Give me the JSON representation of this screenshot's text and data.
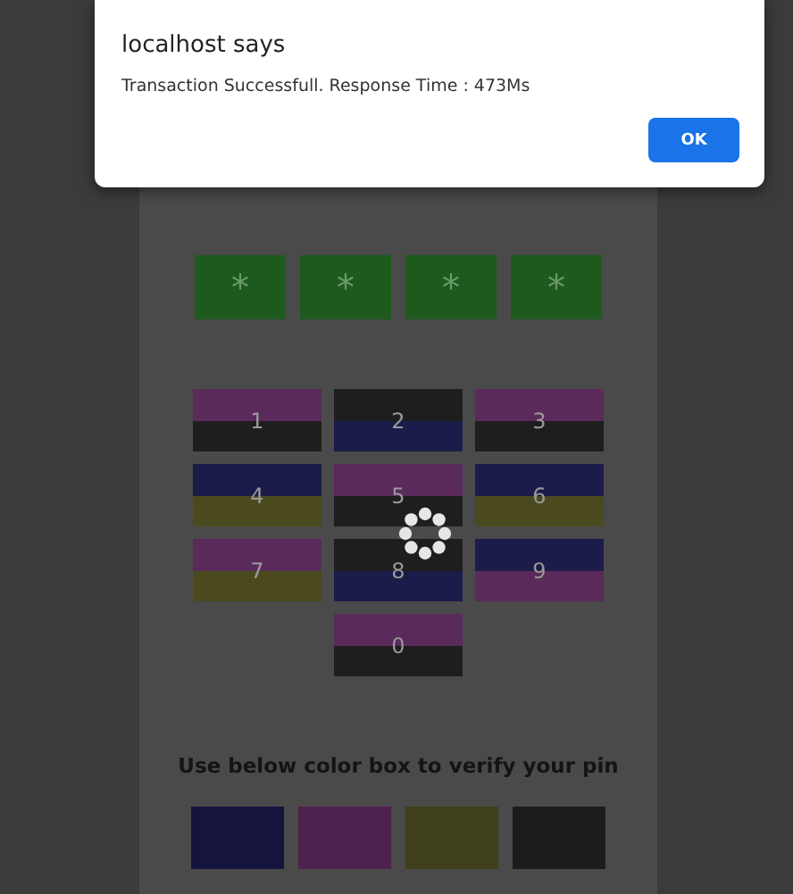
{
  "dialog": {
    "title": "localhost says",
    "message": "Transaction Successfull. Response Time : 473Ms",
    "button": "OK"
  },
  "pin_boxes": [
    "*",
    "*",
    "*",
    "*"
  ],
  "keys": [
    {
      "label": "1",
      "stripes": [
        {
          "color": "#5a2a5a"
        },
        {
          "color": "#1e1e1e"
        }
      ]
    },
    {
      "label": "2",
      "stripes": [
        {
          "color": "#1e1e1e"
        },
        {
          "color": "#1c1c4a"
        }
      ]
    },
    {
      "label": "3",
      "stripes": [
        {
          "color": "#5a2a5a"
        },
        {
          "color": "#1e1e1e"
        }
      ]
    },
    {
      "label": "4",
      "stripes": [
        {
          "color": "#1c1c4a"
        },
        {
          "color": "#4a4a1e"
        }
      ]
    },
    {
      "label": "5",
      "stripes": [
        {
          "color": "#5a2a5a"
        },
        {
          "color": "#1e1e1e"
        }
      ]
    },
    {
      "label": "6",
      "stripes": [
        {
          "color": "#1c1c4a"
        },
        {
          "color": "#4a4a1e"
        }
      ]
    },
    {
      "label": "7",
      "stripes": [
        {
          "color": "#5a2a5a"
        },
        {
          "color": "#4a4a1e"
        }
      ]
    },
    {
      "label": "8",
      "stripes": [
        {
          "color": "#1e1e1e"
        },
        {
          "color": "#1c1c4a"
        }
      ]
    },
    {
      "label": "9",
      "stripes": [
        {
          "color": "#1c1c4a"
        },
        {
          "color": "#5a2a5a"
        }
      ]
    },
    {
      "label": "0",
      "stripes": [
        {
          "color": "#5a2a5a"
        },
        {
          "color": "#1e1e1e"
        }
      ]
    }
  ],
  "instruction": "Use below color box to verify your pin",
  "color_boxes": [
    {
      "color": "#14143f"
    },
    {
      "color": "#4e214e"
    },
    {
      "color": "#3f401a"
    },
    {
      "color": "#1c1c1c"
    }
  ]
}
